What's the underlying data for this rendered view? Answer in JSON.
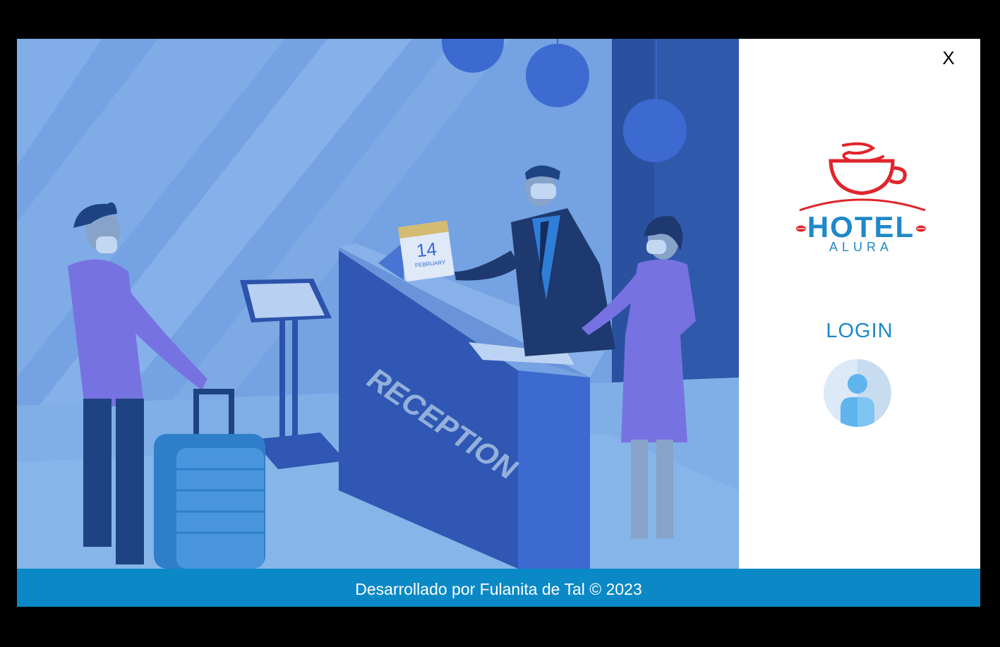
{
  "window": {
    "close_label": "X"
  },
  "illustration": {
    "calendar_day": "14",
    "calendar_month": "FEBRUARY",
    "desk_sign": "RECEPTION"
  },
  "logo": {
    "line1": "HOTEL",
    "line2": "ALURA"
  },
  "login": {
    "label": "LOGIN"
  },
  "footer": {
    "text": "Desarrollado por Fulanita de Tal © 2023"
  },
  "colors": {
    "footer_bg": "#0b89c6",
    "login_text": "#1e88c8",
    "logo_red": "#e0252b",
    "logo_blue": "#1e88c8"
  }
}
